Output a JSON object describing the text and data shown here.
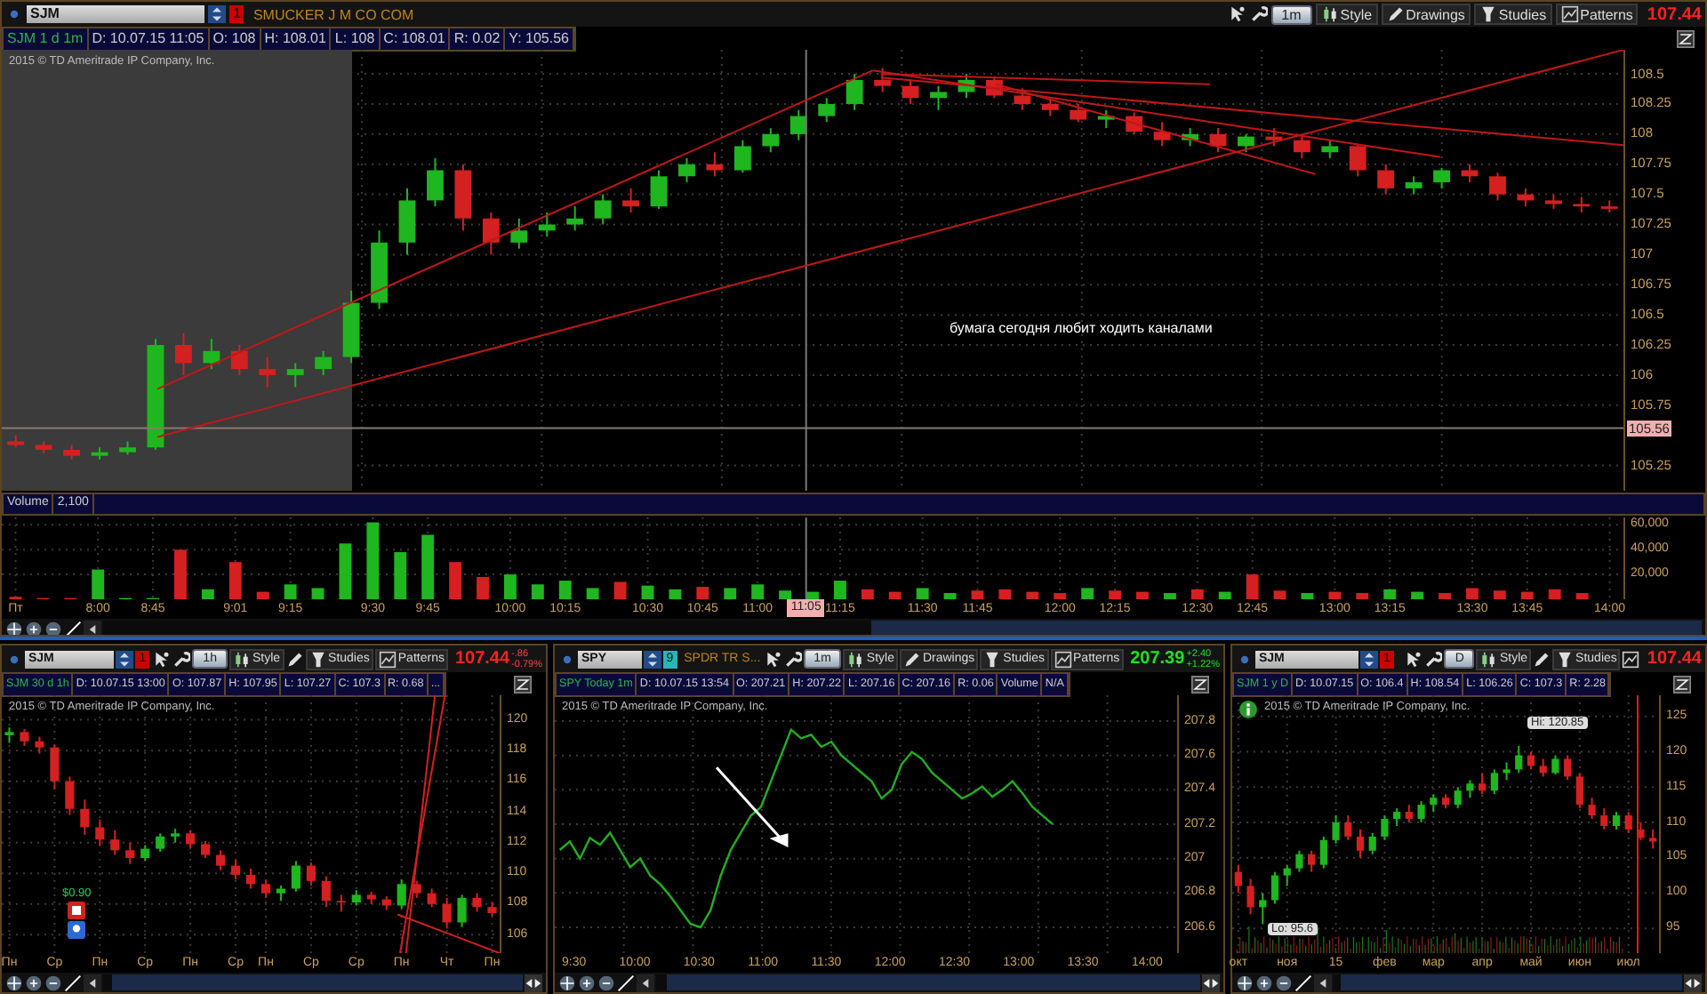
{
  "main": {
    "toolbar": {
      "symbol": "SJM",
      "badge": {
        "label": "1",
        "color": "#cc0000"
      },
      "description": "SMUCKER J M CO COM",
      "aggregation": "1m",
      "buttons": [
        {
          "kind": "style",
          "label": "Style"
        },
        {
          "kind": "drawings",
          "label": "Drawings"
        },
        {
          "kind": "studies",
          "label": "Studies"
        },
        {
          "kind": "patterns",
          "label": "Patterns"
        }
      ],
      "last_price": "107.44",
      "falling": true
    },
    "info": [
      "SJM 1 d 1m",
      "D: 10.07.15 11:05",
      "O: 108",
      "H: 108.01",
      "L: 108",
      "C: 108.01",
      "R: 0.02",
      "Y: 105.56"
    ],
    "copyright": "2015 © TD Ameritrade IP Company, Inc.",
    "annotation": "бумага сегодня любит ходить каналами",
    "chart_data": {
      "type": "candlestick",
      "grid": true,
      "ylim": [
        105.04,
        108.7
      ],
      "yticks": [
        108.5,
        108.25,
        108,
        107.75,
        107.5,
        107.25,
        107,
        106.75,
        106.5,
        106.25,
        106,
        105.75,
        105.25
      ],
      "annotations": [
        "105.56"
      ],
      "categories": [
        null,
        null,
        null,
        null,
        null,
        null,
        null,
        null,
        null,
        null,
        null,
        null,
        null,
        null,
        null,
        null,
        null,
        null,
        null,
        null,
        null,
        null,
        null,
        null,
        null,
        null,
        null,
        null,
        null,
        null,
        null,
        null,
        null,
        null,
        null,
        null,
        null,
        null,
        null,
        null,
        null,
        null,
        null,
        null,
        null,
        null,
        null,
        null,
        null,
        null,
        null,
        null,
        null,
        null,
        null,
        null,
        null,
        null
      ],
      "ohlc": [
        [
          105.45,
          105.5,
          105.4,
          105.42
        ],
        [
          105.42,
          105.45,
          105.35,
          105.38
        ],
        [
          105.38,
          105.42,
          105.3,
          105.33
        ],
        [
          105.33,
          105.4,
          105.3,
          105.36
        ],
        [
          105.36,
          105.45,
          105.34,
          105.4
        ],
        [
          105.4,
          106.3,
          105.38,
          106.25
        ],
        [
          106.25,
          106.35,
          106.0,
          106.1
        ],
        [
          106.1,
          106.3,
          106.05,
          106.2
        ],
        [
          106.2,
          106.25,
          106.0,
          106.05
        ],
        [
          106.05,
          106.15,
          105.9,
          106.0
        ],
        [
          106.0,
          106.1,
          105.9,
          106.05
        ],
        [
          106.05,
          106.2,
          106.0,
          106.15
        ],
        [
          106.15,
          106.7,
          106.1,
          106.6
        ],
        [
          106.6,
          107.2,
          106.55,
          107.1
        ],
        [
          107.1,
          107.55,
          107.0,
          107.45
        ],
        [
          107.45,
          107.8,
          107.4,
          107.7
        ],
        [
          107.7,
          107.75,
          107.2,
          107.3
        ],
        [
          107.3,
          107.35,
          107.0,
          107.1
        ],
        [
          107.1,
          107.3,
          107.05,
          107.2
        ],
        [
          107.2,
          107.35,
          107.15,
          107.25
        ],
        [
          107.25,
          107.4,
          107.2,
          107.3
        ],
        [
          107.3,
          107.5,
          107.25,
          107.45
        ],
        [
          107.45,
          107.55,
          107.35,
          107.4
        ],
        [
          107.4,
          107.7,
          107.38,
          107.65
        ],
        [
          107.65,
          107.8,
          107.6,
          107.75
        ],
        [
          107.75,
          107.85,
          107.65,
          107.7
        ],
        [
          107.7,
          107.95,
          107.68,
          107.9
        ],
        [
          107.9,
          108.05,
          107.85,
          108.0
        ],
        [
          108.0,
          108.2,
          107.95,
          108.15
        ],
        [
          108.15,
          108.3,
          108.1,
          108.25
        ],
        [
          108.25,
          108.5,
          108.2,
          108.45
        ],
        [
          108.45,
          108.55,
          108.35,
          108.4
        ],
        [
          108.4,
          108.45,
          108.25,
          108.3
        ],
        [
          108.3,
          108.4,
          108.2,
          108.35
        ],
        [
          108.35,
          108.5,
          108.3,
          108.45
        ],
        [
          108.45,
          108.48,
          108.3,
          108.32
        ],
        [
          108.32,
          108.38,
          108.2,
          108.25
        ],
        [
          108.25,
          108.3,
          108.15,
          108.2
        ],
        [
          108.2,
          108.25,
          108.1,
          108.12
        ],
        [
          108.12,
          108.2,
          108.05,
          108.15
        ],
        [
          108.15,
          108.18,
          108.0,
          108.02
        ],
        [
          108.02,
          108.1,
          107.9,
          107.95
        ],
        [
          107.95,
          108.05,
          107.9,
          108.0
        ],
        [
          108.0,
          108.05,
          107.85,
          107.9
        ],
        [
          107.9,
          108.0,
          107.85,
          107.98
        ],
        [
          107.98,
          108.05,
          107.9,
          107.95
        ],
        [
          107.95,
          107.98,
          107.8,
          107.85
        ],
        [
          107.85,
          107.95,
          107.8,
          107.9
        ],
        [
          107.9,
          107.92,
          107.65,
          107.7
        ],
        [
          107.7,
          107.75,
          107.5,
          107.55
        ],
        [
          107.55,
          107.65,
          107.5,
          107.6
        ],
        [
          107.6,
          107.72,
          107.55,
          107.7
        ],
        [
          107.7,
          107.75,
          107.6,
          107.65
        ],
        [
          107.65,
          107.68,
          107.45,
          107.5
        ],
        [
          107.5,
          107.55,
          107.4,
          107.45
        ],
        [
          107.45,
          107.5,
          107.38,
          107.42
        ],
        [
          107.42,
          107.48,
          107.35,
          107.4
        ],
        [
          107.4,
          107.45,
          107.35,
          107.38
        ]
      ]
    },
    "volume": {
      "label": "Volume",
      "value": "2,100",
      "chart_data": {
        "type": "bar",
        "grid": true,
        "ylim": [
          0,
          66000
        ],
        "yticks": [
          {
            "value": 60000,
            "label": "60,000"
          },
          {
            "value": 40000,
            "label": "40,000"
          },
          {
            "value": 20000,
            "label": "20,000"
          }
        ],
        "annotations": [
          "11:05"
        ],
        "categories": [
          "Пт",
          null,
          null,
          "8:00",
          null,
          "8:45",
          null,
          null,
          "9:01",
          null,
          "9:15",
          null,
          null,
          "9:30",
          null,
          "9:45",
          null,
          null,
          "10:00",
          null,
          "10:15",
          null,
          null,
          "10:30",
          null,
          "10:45",
          null,
          "11:00",
          null,
          null,
          "11:15",
          null,
          null,
          "11:30",
          null,
          "11:45",
          null,
          null,
          "12:00",
          null,
          "12:15",
          null,
          null,
          "12:30",
          null,
          "12:45",
          null,
          null,
          "13:00",
          null,
          "13:15",
          null,
          null,
          "13:30",
          null,
          "13:45",
          null,
          null,
          "14:00"
        ],
        "values": [
          2000,
          1000,
          1000,
          24000,
          1000,
          1000,
          40000,
          8000,
          30000,
          6000,
          12000,
          9000,
          45000,
          62000,
          38000,
          52000,
          30000,
          18000,
          20000,
          12000,
          15000,
          9000,
          14000,
          11000,
          8000,
          10000,
          9000,
          12000,
          7000,
          6000,
          15000,
          8000,
          6000,
          9000,
          5000,
          7000,
          8000,
          6000,
          5000,
          9000,
          7000,
          6000,
          5000,
          8000,
          6000,
          20000,
          7000,
          5000,
          6000,
          5000,
          8000,
          6000,
          5000,
          9000,
          7000,
          6000,
          8000,
          5000,
          null
        ]
      }
    }
  },
  "panels": [
    {
      "toolbar": {
        "symbol": "SJM",
        "badge": {
          "label": "1",
          "color": "#cc0000"
        },
        "aggregation": "1h",
        "buttons": [
          {
            "kind": "style",
            "label": "Style"
          },
          {
            "kind": "drawings"
          },
          {
            "kind": "studies",
            "label": "Studies"
          },
          {
            "kind": "patterns",
            "label": "Patterns"
          }
        ],
        "last_price": "107.44",
        "falling": true,
        "change": "-.86",
        "change_pct": "-0.79%"
      },
      "info": [
        "SJM 30 d 1h",
        "D: 10.07.15 13:00",
        "O: 107.87",
        "H: 107.95",
        "L: 107.27",
        "C: 107.3",
        "R: 0.68",
        "..."
      ],
      "copyright": "2015 © TD Ameritrade IP Company, Inc.",
      "marker": "$0.90",
      "chart_data": {
        "type": "candlestick",
        "grid": true,
        "ylim": [
          104.8,
          121.6
        ],
        "yticks": [
          120,
          118,
          116,
          114,
          112,
          110,
          108,
          106
        ],
        "categories": [
          "Пн",
          null,
          null,
          "Ср",
          null,
          null,
          "Пн",
          null,
          null,
          "Ср",
          null,
          null,
          "Пн",
          null,
          null,
          "Ср",
          null,
          "Пн",
          null,
          null,
          "Ср",
          null,
          null,
          "Ср",
          null,
          null,
          "Пн",
          null,
          null,
          "Чт",
          null,
          null,
          "Пн"
        ],
        "ohlc": [
          [
            119,
            119.5,
            118.5,
            119.2
          ],
          [
            119.2,
            119.4,
            118.3,
            118.6
          ],
          [
            118.6,
            118.9,
            117.8,
            118.2
          ],
          [
            118.2,
            118.4,
            115.5,
            116
          ],
          [
            116,
            116.3,
            113.8,
            114.2
          ],
          [
            114.2,
            114.8,
            112.5,
            113
          ],
          [
            113,
            113.5,
            111.8,
            112.2
          ],
          [
            112.2,
            112.8,
            111.2,
            111.5
          ],
          [
            111.5,
            112,
            110.6,
            111
          ],
          [
            111,
            111.8,
            110.8,
            111.6
          ],
          [
            111.6,
            112.6,
            111.4,
            112.4
          ],
          [
            112.4,
            112.9,
            112,
            112.6
          ],
          [
            112.6,
            112.8,
            111.6,
            111.9
          ],
          [
            111.9,
            112.1,
            111,
            111.2
          ],
          [
            111.2,
            111.5,
            110.2,
            110.5
          ],
          [
            110.5,
            110.9,
            109.6,
            109.9
          ],
          [
            109.9,
            110.3,
            109,
            109.3
          ],
          [
            109.3,
            109.6,
            108.4,
            108.7
          ],
          [
            108.7,
            109.2,
            108.2,
            109
          ],
          [
            109,
            110.8,
            108.8,
            110.5
          ],
          [
            110.5,
            110.7,
            109.2,
            109.5
          ],
          [
            109.5,
            109.8,
            107.8,
            108.2
          ],
          [
            108.2,
            108.6,
            107.5,
            108.1
          ],
          [
            108.1,
            108.9,
            107.9,
            108.6
          ],
          [
            108.6,
            108.8,
            108,
            108.3
          ],
          [
            108.3,
            108.5,
            107.6,
            107.9
          ],
          [
            107.9,
            109.6,
            107.7,
            109.3
          ],
          [
            109.3,
            109.5,
            108.4,
            108.7
          ],
          [
            108.7,
            109,
            107.8,
            108
          ],
          [
            108,
            108.4,
            106.4,
            106.8
          ],
          [
            106.8,
            108.6,
            106.5,
            108.4
          ],
          [
            108.4,
            108.7,
            107.5,
            107.8
          ],
          [
            107.8,
            108.1,
            107.2,
            107.4
          ]
        ]
      }
    },
    {
      "toolbar": {
        "symbol": "SPY",
        "badge": {
          "label": "9",
          "color": "#22b8b8"
        },
        "description": "SPDR TR S...",
        "aggregation": "1m",
        "buttons": [
          {
            "kind": "style",
            "label": "Style"
          },
          {
            "kind": "drawings",
            "label": "Drawings"
          },
          {
            "kind": "studies",
            "label": "Studies"
          },
          {
            "kind": "patterns",
            "label": "Patterns"
          }
        ],
        "last_price": "207.39",
        "falling": false,
        "change": "+2.40",
        "change_pct": "+1.22%"
      },
      "info": [
        "SPY Today 1m",
        "D: 10.07.15 13:54",
        "O: 207.21",
        "H: 207.22",
        "L: 207.16",
        "C: 207.16",
        "R: 0.06",
        "Volume",
        "N/A"
      ],
      "copyright": "2015 © TD Ameritrade IP Company, Inc.",
      "chart_data": {
        "type": "line",
        "grid": true,
        "ylim": [
          206.45,
          207.95
        ],
        "yticks": [
          207.8,
          207.6,
          207.4,
          207.2,
          207,
          206.8,
          206.6
        ],
        "series": [
          {
            "color": "#22b022",
            "values": [
              207.05,
              207.1,
              207.0,
              207.12,
              207.08,
              207.15,
              207.05,
              206.95,
              207.0,
              206.9,
              206.85,
              206.78,
              206.7,
              206.62,
              206.6,
              206.7,
              206.9,
              207.05,
              207.15,
              207.25,
              207.3,
              207.45,
              207.6,
              207.75,
              207.7,
              207.72,
              207.65,
              207.68,
              207.6,
              207.55,
              207.5,
              207.45,
              207.35,
              207.4,
              207.55,
              207.62,
              207.58,
              207.5,
              207.45,
              207.4,
              207.35,
              207.38,
              207.42,
              207.36,
              207.4,
              207.45,
              207.38,
              207.3,
              207.25,
              207.2
            ]
          }
        ]
      },
      "time_axis": [
        "9:30",
        "10:00",
        "10:30",
        "11:00",
        "11:30",
        "12:00",
        "12:30",
        "13:00",
        "13:30",
        "14:00"
      ]
    },
    {
      "toolbar": {
        "symbol": "SJM",
        "badge": {
          "label": "1",
          "color": "#cc0000"
        },
        "aggregation": "D",
        "buttons": [
          {
            "kind": "style",
            "label": "Style"
          },
          {
            "kind": "drawings"
          },
          {
            "kind": "studies",
            "label": "Studies"
          },
          {
            "kind": "patterns"
          }
        ],
        "last_price": "107.44",
        "falling": true
      },
      "info": [
        "SJM 1 y D",
        "D: 10.07.15",
        "O: 106.4",
        "H: 108.54",
        "L: 106.26",
        "C: 107.3",
        "R: 2.28"
      ],
      "copyright": "2015 © TD Ameritrade IP Company, Inc.",
      "high_label": "Hi: 120.85",
      "low_label": "Lo: 95.6",
      "chart_data": {
        "type": "candlestick",
        "grid": true,
        "ylim": [
          91.5,
          128
        ],
        "yticks": [
          125,
          120,
          115,
          110,
          105,
          100,
          95
        ],
        "categories": [
          "окт",
          null,
          null,
          null,
          "ноя",
          null,
          null,
          null,
          "15",
          null,
          null,
          null,
          "фев",
          null,
          null,
          null,
          "мар",
          null,
          null,
          null,
          "апр",
          null,
          null,
          null,
          "май",
          null,
          null,
          null,
          "июн",
          null,
          null,
          null,
          "июл",
          null,
          null
        ],
        "ohlc": [
          [
            103,
            104,
            100,
            101
          ],
          [
            101,
            102,
            97,
            98
          ],
          [
            98,
            100,
            95.6,
            99
          ],
          [
            99,
            103,
            98.5,
            102.5
          ],
          [
            102.5,
            104,
            101,
            103.5
          ],
          [
            103.5,
            106,
            103,
            105.5
          ],
          [
            105.5,
            106,
            103,
            104
          ],
          [
            104,
            108,
            103.5,
            107.5
          ],
          [
            107.5,
            111,
            107,
            110
          ],
          [
            110,
            111,
            107.5,
            108
          ],
          [
            108,
            109,
            105,
            106
          ],
          [
            106,
            108.5,
            105.5,
            108
          ],
          [
            108,
            111,
            107.5,
            110.5
          ],
          [
            110.5,
            112,
            109.5,
            111.5
          ],
          [
            111.5,
            112.5,
            110,
            110.5
          ],
          [
            110.5,
            113,
            110,
            112.5
          ],
          [
            112.5,
            114,
            111.5,
            113.5
          ],
          [
            113.5,
            114,
            112,
            112.5
          ],
          [
            112.5,
            115,
            112,
            114.5
          ],
          [
            114.5,
            116,
            113.5,
            115.5
          ],
          [
            115.5,
            117,
            114,
            114.5
          ],
          [
            114.5,
            117.5,
            114,
            117
          ],
          [
            117,
            118.5,
            116,
            117.5
          ],
          [
            117.5,
            120.85,
            117,
            119.5
          ],
          [
            119.5,
            120,
            117.5,
            118
          ],
          [
            118,
            119,
            116.5,
            117
          ],
          [
            117,
            119.5,
            116.8,
            119
          ],
          [
            119,
            119.5,
            116,
            116.5
          ],
          [
            116.5,
            117,
            112,
            112.5
          ],
          [
            112.5,
            113.5,
            110.5,
            111
          ],
          [
            111,
            112,
            109,
            109.5
          ],
          [
            109.5,
            111.5,
            109,
            111
          ],
          [
            111,
            111.5,
            108.5,
            109
          ],
          [
            109,
            110,
            107.5,
            107.8
          ],
          [
            107.8,
            109,
            106.3,
            107.3
          ]
        ]
      }
    }
  ]
}
